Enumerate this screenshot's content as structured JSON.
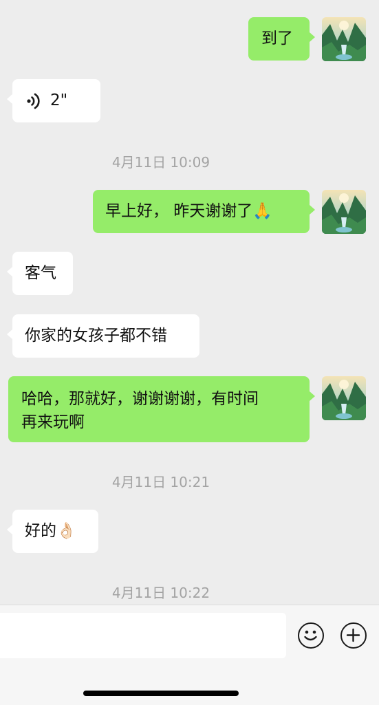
{
  "messages": [
    {
      "side": "out",
      "text": "到了"
    },
    {
      "side": "in",
      "voice_duration": "2\""
    },
    {
      "time": "4月11日 10:09"
    },
    {
      "side": "out",
      "text": "早上好， 昨天谢谢了🙏"
    },
    {
      "side": "in",
      "text": "客气"
    },
    {
      "side": "in",
      "text": "你家的女孩子都不错"
    },
    {
      "side": "out",
      "line1": "哈哈，那就好，谢谢谢谢，有时间",
      "line2": "再来玩啊"
    },
    {
      "time": "4月11日 10:21"
    },
    {
      "side": "in",
      "text": "好的👌🏻"
    },
    {
      "time": "4月11日 10:22"
    }
  ],
  "icons": {
    "voice": "voice-wave-icon",
    "emoji": "smiley-face-icon",
    "more": "plus-circle-icon",
    "avatar": "landscape-avatar"
  },
  "colors": {
    "background": "#ededed",
    "outgoing_bubble": "#95ec69",
    "incoming_bubble": "#ffffff",
    "timestamp": "#a3a3a3"
  }
}
